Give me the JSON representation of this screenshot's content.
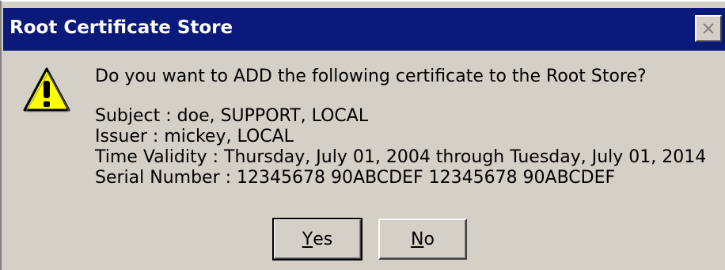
{
  "window": {
    "title": "Root Certificate Store",
    "close_icon": "close-icon"
  },
  "icon": "warning-icon",
  "message": {
    "question": "Do you want to ADD the following certificate to the Root Store?",
    "subject": "Subject : doe, SUPPORT, LOCAL",
    "issuer": "Issuer : mickey, LOCAL",
    "validity": "Time Validity : Thursday, July 01, 2004 through Tuesday, July 01, 2014",
    "serial": "Serial Number : 12345678 90ABCDEF 12345678 90ABCDEF"
  },
  "buttons": {
    "yes": {
      "mnemonic": "Y",
      "rest": "es"
    },
    "no": {
      "mnemonic": "N",
      "rest": "o"
    }
  },
  "colors": {
    "titlebar": "#0a1a7a",
    "face": "#d4d0c8",
    "icon_fill": "#ffff00"
  }
}
